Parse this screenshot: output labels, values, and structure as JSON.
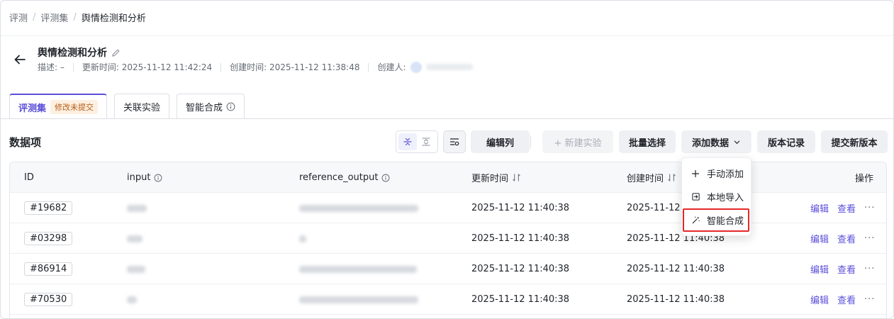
{
  "breadcrumb": [
    "评测",
    "评测集",
    "舆情检测和分析"
  ],
  "header": {
    "title": "舆情检测和分析",
    "description": "描述: –",
    "updated": "更新时间: 2025-11-12 11:42:24",
    "created": "创建时间: 2025-11-12 11:38:48",
    "creator_label": "创建人:"
  },
  "tabs": [
    {
      "label": "评测集",
      "badge": "修改未提交"
    },
    {
      "label": "关联实验"
    },
    {
      "label": "智能合成"
    }
  ],
  "section_title": "数据项",
  "toolbar": {
    "edit_columns": "编辑列",
    "new_experiment": "+ 新建实验",
    "batch_select": "批量选择",
    "add_data": "添加数据",
    "version_history": "版本记录",
    "submit_version": "提交新版本"
  },
  "table": {
    "headers": {
      "id": "ID",
      "input": "input",
      "reference_output": "reference_output",
      "updated": "更新时间",
      "created": "创建时间",
      "actions": "操作"
    },
    "rows": [
      {
        "id": "#19682",
        "updated": "2025-11-12 11:40:38",
        "created": "2025-11-12 11:40:38"
      },
      {
        "id": "#03298",
        "updated": "2025-11-12 11:40:38",
        "created": "2025-11-12 11:40:38"
      },
      {
        "id": "#86914",
        "updated": "2025-11-12 11:40:38",
        "created": "2025-11-12 11:40:38"
      },
      {
        "id": "#70530",
        "updated": "2025-11-12 11:40:38",
        "created": "2025-11-12 11:40:38"
      }
    ],
    "action_edit": "编辑",
    "action_view": "查看",
    "action_more": "···"
  },
  "dropdown": {
    "items": [
      "手动添加",
      "本地导入",
      "智能合成"
    ],
    "icons": [
      "plus-icon",
      "import-icon",
      "magic-wand-icon"
    ]
  },
  "colors": {
    "accent": "#5b4fd9",
    "highlight": "#e5282a",
    "badge_bg": "#fdf0e1",
    "badge_text": "#b65d17"
  }
}
